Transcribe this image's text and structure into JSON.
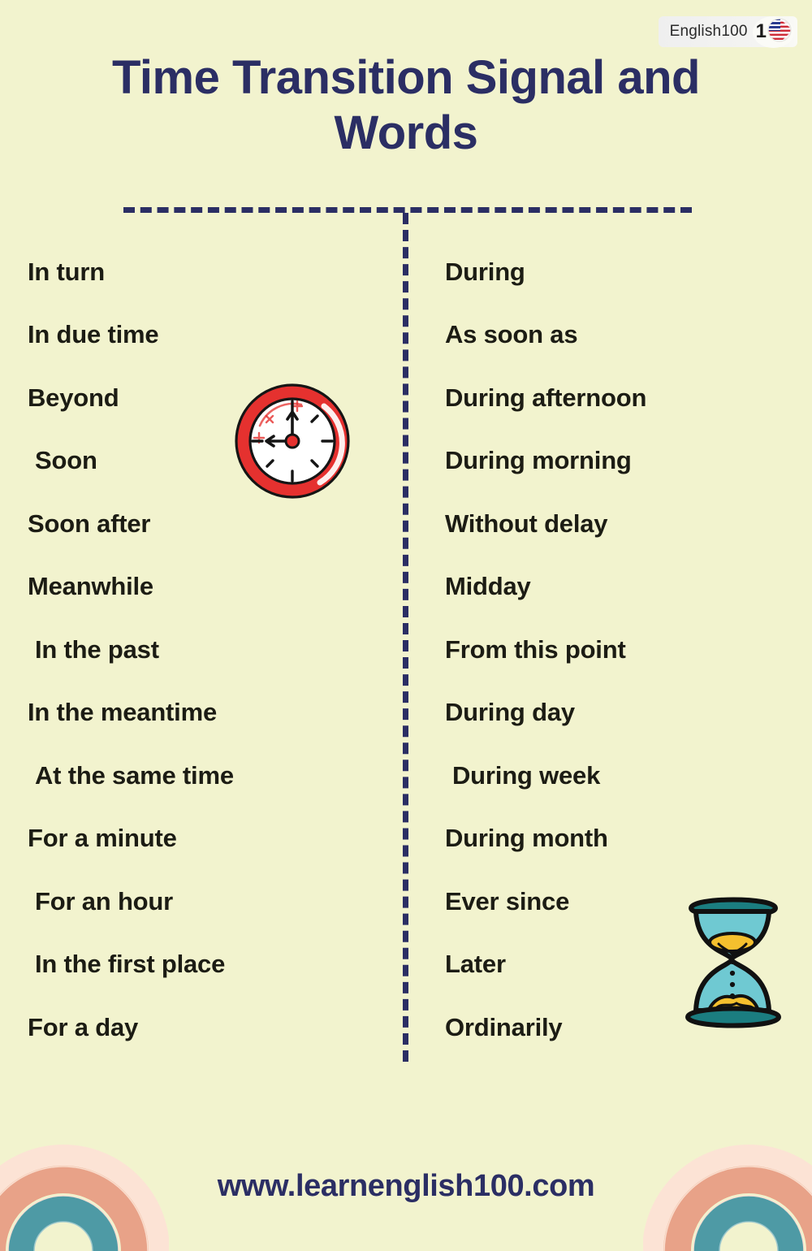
{
  "background_color": "#F2F3CE",
  "brand": {
    "badge_text": "English100",
    "mark_number": "1",
    "flag_icon": "us-uk-flag-icon"
  },
  "header": {
    "title": "Time Transition Signal and Words",
    "title_color": "#2B2E64"
  },
  "divider": {
    "style": "dashed",
    "color": "#2B2E64"
  },
  "columns": {
    "left": {
      "items": [
        {
          "label": "In turn",
          "indent": false
        },
        {
          "label": "In due time",
          "indent": false
        },
        {
          "label": "Beyond",
          "indent": false
        },
        {
          "label": "Soon",
          "indent": true
        },
        {
          "label": "Soon after",
          "indent": false
        },
        {
          "label": "Meanwhile",
          "indent": false
        },
        {
          "label": "In the past",
          "indent": true
        },
        {
          "label": "In the meantime",
          "indent": false
        },
        {
          "label": "At the same time",
          "indent": true
        },
        {
          "label": "For a minute",
          "indent": false
        },
        {
          "label": "For an hour",
          "indent": true
        },
        {
          "label": "In the first place",
          "indent": true
        },
        {
          "label": "For a day",
          "indent": false
        }
      ]
    },
    "right": {
      "items": [
        {
          "label": "During",
          "indent": false
        },
        {
          "label": "As soon as",
          "indent": false
        },
        {
          "label": "During afternoon",
          "indent": false
        },
        {
          "label": "During morning",
          "indent": false
        },
        {
          "label": "Without delay",
          "indent": false
        },
        {
          "label": "Midday",
          "indent": false
        },
        {
          "label": "From this point",
          "indent": false
        },
        {
          "label": "During day",
          "indent": false
        },
        {
          "label": "During week",
          "indent": true
        },
        {
          "label": "During month",
          "indent": false
        },
        {
          "label": "Ever since",
          "indent": false
        },
        {
          "label": "Later",
          "indent": false
        },
        {
          "label": "Ordinarily",
          "indent": false
        }
      ]
    }
  },
  "illustrations": {
    "clock": {
      "name": "clock-icon",
      "ring_color": "#E5312F",
      "face_color": "#FFFFFF",
      "hand_color": "#111111"
    },
    "hourglass": {
      "name": "hourglass-icon",
      "glass_color": "#6FC9D2",
      "cap_color": "#1B7D80",
      "sand_color": "#F5C02E"
    }
  },
  "decorations": {
    "rainbow_colors": [
      "#FCE3D5",
      "#E8A288",
      "#4E9AA5"
    ]
  },
  "footer": {
    "url": "www.learnenglish100.com",
    "url_color": "#2B2E64"
  }
}
